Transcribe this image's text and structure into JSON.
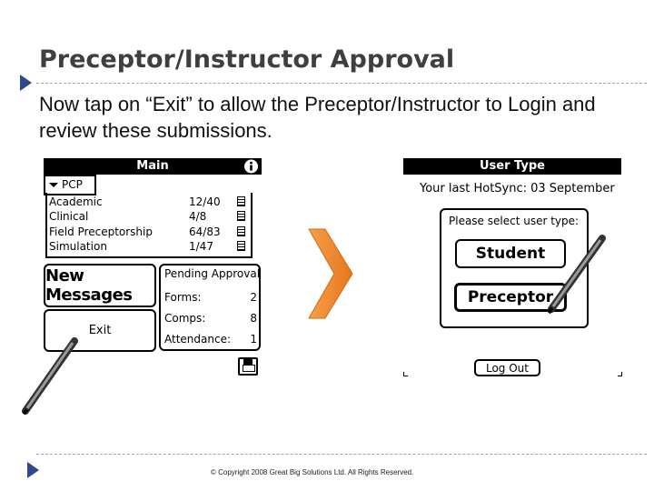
{
  "slide": {
    "title": "Preceptor/Instructor Approval",
    "instruction": "Now tap on “Exit” to allow the Preceptor/Instructor to Login and review these submissions.",
    "copyright": "© Copyright 2008 Great Big Solutions Ltd. All Rights Reserved."
  },
  "main_screen": {
    "title": "Main",
    "info_icon": "info-icon",
    "category_dropdown": "PCP",
    "activities": [
      {
        "name": "Academic",
        "value": "12/40"
      },
      {
        "name": "Clinical",
        "value": "4/8"
      },
      {
        "name": "Field Preceptorship",
        "value": "64/83"
      },
      {
        "name": "Simulation",
        "value": "1/47"
      }
    ],
    "new_messages_label": "New Messages",
    "exit_label": "Exit",
    "pending": {
      "header": "Pending Approval",
      "rows": [
        {
          "label": "Forms:",
          "value": "2"
        },
        {
          "label": "Comps:",
          "value": "8"
        },
        {
          "label": "Attendance:",
          "value": "1"
        }
      ]
    },
    "save_icon": "floppy-disk-icon"
  },
  "user_type_screen": {
    "title": "User Type",
    "last_hotsync": "Your last HotSync:  03 September",
    "prompt": "Please select user type:",
    "student_label": "Student",
    "preceptor_label": "Preceptor",
    "logout_label": "Log Out"
  },
  "colors": {
    "title_text": "#3f3f3f",
    "bullet": "#2e4a8a",
    "arrow_orange": "#f08a2c",
    "titlebar": "#000000"
  }
}
